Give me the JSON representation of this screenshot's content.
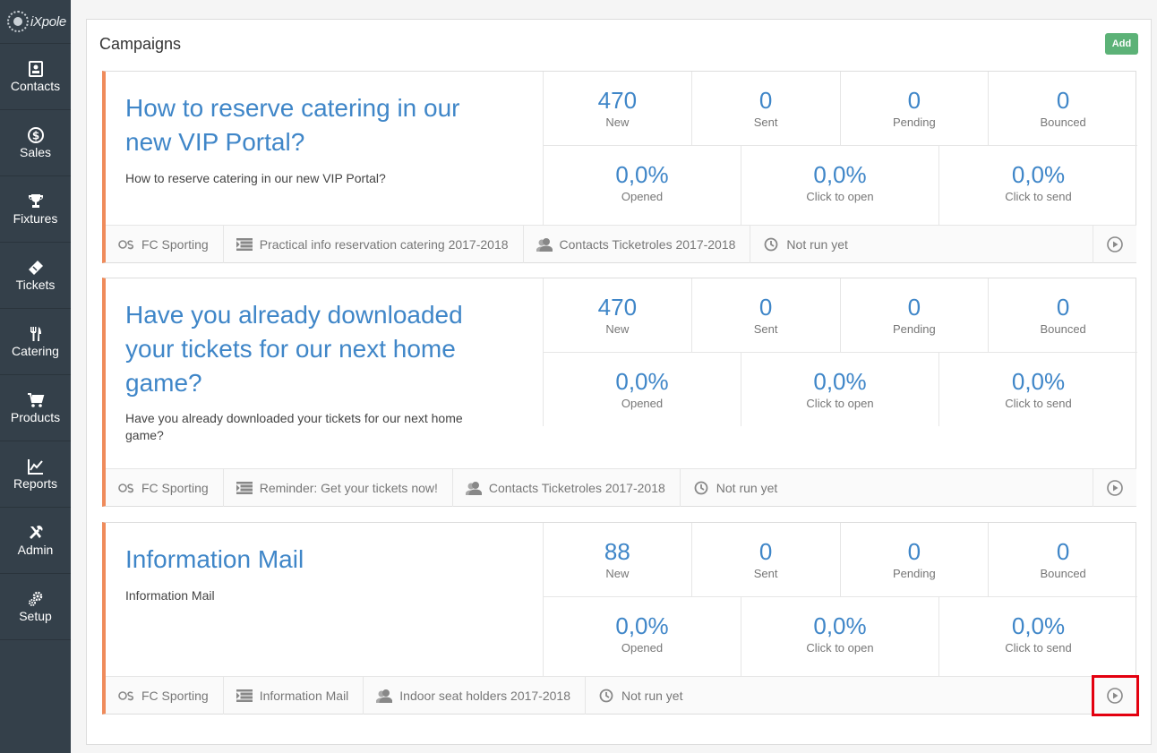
{
  "app": {
    "logo_text": "iXpole"
  },
  "sidebar": {
    "items": [
      {
        "label": "Contacts",
        "icon": "contacts-icon"
      },
      {
        "label": "Sales",
        "icon": "dollar-icon"
      },
      {
        "label": "Fixtures",
        "icon": "trophy-icon"
      },
      {
        "label": "Tickets",
        "icon": "ticket-icon"
      },
      {
        "label": "Catering",
        "icon": "cutlery-icon"
      },
      {
        "label": "Products",
        "icon": "cart-icon"
      },
      {
        "label": "Reports",
        "icon": "chart-icon"
      },
      {
        "label": "Admin",
        "icon": "tools-icon"
      },
      {
        "label": "Setup",
        "icon": "gears-icon"
      }
    ]
  },
  "panel": {
    "title": "Campaigns",
    "add_label": "Add"
  },
  "campaigns": [
    {
      "title": "How to reserve catering in our new VIP Portal?",
      "description": "How to reserve catering in our new VIP Portal?",
      "stats": {
        "new": "470",
        "new_label": "New",
        "sent": "0",
        "sent_label": "Sent",
        "pending": "0",
        "pending_label": "Pending",
        "bounced": "0",
        "bounced_label": "Bounced",
        "opened": "0,0%",
        "opened_label": "Opened",
        "click_open": "0,0%",
        "click_open_label": "Click to open",
        "click_send": "0,0%",
        "click_send_label": "Click to send"
      },
      "footer": {
        "club": "FC Sporting",
        "template": "Practical info reservation catering 2017-2018",
        "audience": "Contacts Ticketroles 2017-2018",
        "status": "Not run yet"
      }
    },
    {
      "title": "Have you already downloaded your tickets for our next home game?",
      "description": "Have you already downloaded your tickets for our next home game?",
      "stats": {
        "new": "470",
        "new_label": "New",
        "sent": "0",
        "sent_label": "Sent",
        "pending": "0",
        "pending_label": "Pending",
        "bounced": "0",
        "bounced_label": "Bounced",
        "opened": "0,0%",
        "opened_label": "Opened",
        "click_open": "0,0%",
        "click_open_label": "Click to open",
        "click_send": "0,0%",
        "click_send_label": "Click to send"
      },
      "footer": {
        "club": "FC Sporting",
        "template": "Reminder: Get your tickets now!",
        "audience": "Contacts Ticketroles 2017-2018",
        "status": "Not run yet"
      }
    },
    {
      "title": "Information Mail",
      "description": "Information Mail",
      "stats": {
        "new": "88",
        "new_label": "New",
        "sent": "0",
        "sent_label": "Sent",
        "pending": "0",
        "pending_label": "Pending",
        "bounced": "0",
        "bounced_label": "Bounced",
        "opened": "0,0%",
        "opened_label": "Opened",
        "click_open": "0,0%",
        "click_open_label": "Click to open",
        "click_send": "0,0%",
        "click_send_label": "Click to send"
      },
      "footer": {
        "club": "FC Sporting",
        "template": "Information Mail",
        "audience": "Indoor seat holders 2017-2018",
        "status": "Not run yet"
      }
    }
  ],
  "colors": {
    "accent": "#3f86c8",
    "card_border": "#ef8b5b",
    "add_button": "#5cb277",
    "sidebar": "#34404a",
    "highlight": "#e3000f"
  }
}
